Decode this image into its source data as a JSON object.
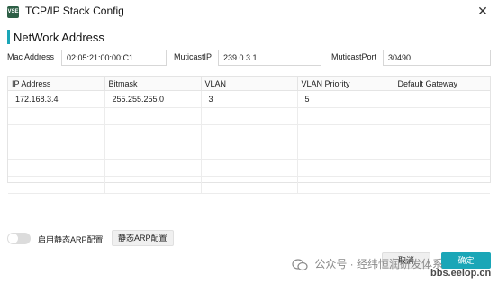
{
  "window": {
    "title": "TCP/IP Stack Config",
    "icon_label": "VSE",
    "close_glyph": "✕"
  },
  "section": {
    "title": "NetWork Address"
  },
  "fields": {
    "mac_label": "Mac Address",
    "mac_value": "02:05:21:00:00:C1",
    "mcast_ip_label": "MuticastIP",
    "mcast_ip_value": "239.0.3.1",
    "mcast_port_label": "MuticastPort",
    "mcast_port_value": "30490"
  },
  "table": {
    "headers": [
      "IP Address",
      "Bitmask",
      "VLAN",
      "VLAN Priority",
      "Default Gateway"
    ],
    "rows": [
      [
        "172.168.3.4",
        "255.255.255.0",
        "3",
        "5",
        ""
      ],
      [
        "",
        "",
        "",
        "",
        ""
      ],
      [
        "",
        "",
        "",
        "",
        ""
      ],
      [
        "",
        "",
        "",
        "",
        ""
      ],
      [
        "",
        "",
        "",
        "",
        ""
      ],
      [
        "",
        "",
        "",
        "",
        ""
      ]
    ]
  },
  "footer": {
    "toggle_label": "启用静态ARP配置",
    "toggle_on": false,
    "arp_button": "静态ARP配置",
    "cancel_button": "取消",
    "ok_button": "确定"
  },
  "watermark": {
    "text": "公众号 · 经纬恒润研发体系",
    "site": "bbs.eelop.cn"
  },
  "colors": {
    "accent": "#1aa6b7",
    "icon_bg": "#2d5f46"
  }
}
